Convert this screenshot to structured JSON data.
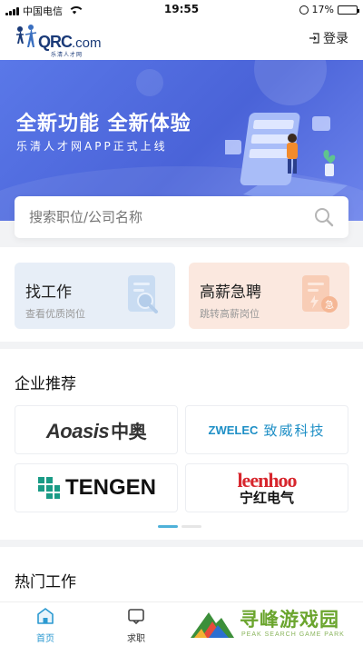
{
  "status_bar": {
    "carrier": "中国电信",
    "time": "19:55",
    "battery": "17%",
    "battery_level": 0.17
  },
  "header": {
    "logo_text": "QRC",
    "logo_domain": ".com",
    "logo_sub": "乐清人才网",
    "login_label": "登录",
    "login_icon": "login-icon"
  },
  "banner": {
    "title": "全新功能  全新体验",
    "subtitle": "乐清人才网APP正式上线"
  },
  "search": {
    "placeholder": "搜索职位/公司名称",
    "icon": "search-icon"
  },
  "quick_cards": [
    {
      "title": "找工作",
      "desc": "查看优质岗位",
      "icon": "document-search-icon",
      "color": "#e7eef7"
    },
    {
      "title": "高薪急聘",
      "desc": "跳转高薪岗位",
      "icon": "urgent-document-icon",
      "color": "#fbe8df"
    }
  ],
  "enterprise": {
    "title": "企业推荐",
    "companies": [
      {
        "name_en": "Aoasis",
        "name_cn": "中奥"
      },
      {
        "name_en": "ZWELEC",
        "name_cn": "致威科技"
      },
      {
        "name_en": "TENGEN",
        "name_cn": ""
      },
      {
        "name_en": "leenhoo",
        "name_cn": "宁红电气"
      }
    ]
  },
  "hot_jobs": {
    "title": "热门工作"
  },
  "tabbar": {
    "tabs": [
      {
        "label": "首页",
        "icon": "home-icon",
        "active": true
      },
      {
        "label": "求职",
        "icon": "job-icon",
        "active": false
      }
    ]
  },
  "watermark": {
    "title": "寻峰游戏园",
    "subtitle": "PEAK SEARCH GAME PARK"
  },
  "colors": {
    "accent": "#2c9ad1",
    "banner": "#4a63d8",
    "hire_card": "#fbe8df",
    "find_card": "#e7eef7"
  }
}
